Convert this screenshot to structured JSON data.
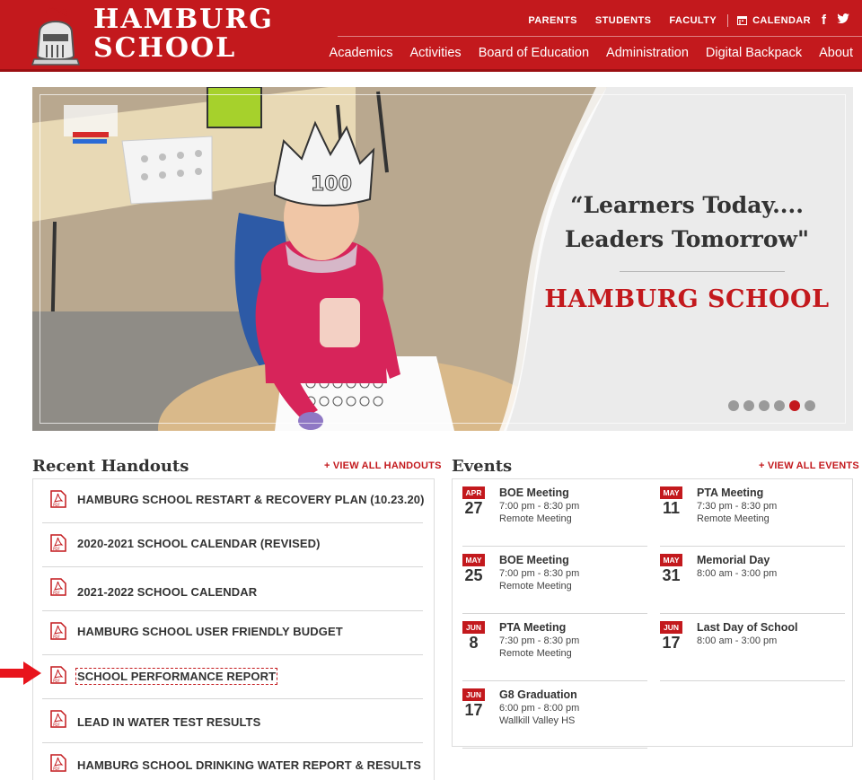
{
  "brand": {
    "line1": "HAMBURG",
    "line2": "SCHOOL",
    "accent": "#c3191d"
  },
  "utility_nav": [
    {
      "label": "PARENTS"
    },
    {
      "label": "STUDENTS"
    },
    {
      "label": "FACULTY"
    }
  ],
  "calendar_link": {
    "label": "CALENDAR",
    "icon": "calendar-icon"
  },
  "social": [
    {
      "icon": "facebook-icon",
      "glyph": "f"
    },
    {
      "icon": "twitter-icon",
      "glyph": "🐦"
    }
  ],
  "main_nav": [
    {
      "label": "Academics"
    },
    {
      "label": "Activities"
    },
    {
      "label": "Board of Education"
    },
    {
      "label": "Administration"
    },
    {
      "label": "Digital Backpack"
    },
    {
      "label": "About"
    }
  ],
  "hero": {
    "slogan_line1": "“Learners Today....",
    "slogan_line2": "Leaders Tomorrow\"",
    "school_name": "HAMBURG SCHOOL",
    "slide_count": 6,
    "active_slide": 5
  },
  "handouts": {
    "title": "Recent Handouts",
    "view_all": "+ VIEW ALL HANDOUTS",
    "items": [
      {
        "label": "HAMBURG SCHOOL RESTART & RECOVERY PLAN (10.23.20)",
        "icon": "pdf-icon"
      },
      {
        "label": "2020-2021 SCHOOL CALENDAR (REVISED)",
        "icon": "pdf-icon"
      },
      {
        "label": "2021-2022 SCHOOL CALENDAR",
        "icon": "pdf-icon"
      },
      {
        "label": "HAMBURG SCHOOL USER FRIENDLY BUDGET",
        "icon": "pdf-icon"
      },
      {
        "label": "SCHOOL PERFORMANCE REPORT",
        "icon": "pdf-icon",
        "focused": true
      },
      {
        "label": "LEAD IN WATER TEST RESULTS",
        "icon": "pdf-icon"
      },
      {
        "label": "HAMBURG SCHOOL DRINKING WATER REPORT & RESULTS",
        "icon": "pdf-icon"
      }
    ]
  },
  "events": {
    "title": "Events",
    "view_all": "+ VIEW ALL EVENTS",
    "items": [
      {
        "month": "APR",
        "day": "27",
        "title": "BOE Meeting",
        "time": "7:00 pm - 8:30 pm",
        "location": "Remote Meeting"
      },
      {
        "month": "MAY",
        "day": "11",
        "title": "PTA Meeting",
        "time": "7:30 pm - 8:30 pm",
        "location": "Remote Meeting"
      },
      {
        "month": "MAY",
        "day": "25",
        "title": "BOE Meeting",
        "time": "7:00 pm - 8:30 pm",
        "location": "Remote Meeting"
      },
      {
        "month": "MAY",
        "day": "31",
        "title": "Memorial Day",
        "time": "8:00 am - 3:00 pm",
        "location": ""
      },
      {
        "month": "JUN",
        "day": "8",
        "title": "PTA Meeting",
        "time": "7:30 pm - 8:30 pm",
        "location": "Remote Meeting"
      },
      {
        "month": "JUN",
        "day": "17",
        "title": "Last Day of School",
        "time": "8:00 am - 3:00 pm",
        "location": ""
      },
      {
        "month": "JUN",
        "day": "17",
        "title": "G8 Graduation",
        "time": "6:00 pm - 8:00 pm",
        "location": "Wallkill Valley HS"
      }
    ]
  }
}
